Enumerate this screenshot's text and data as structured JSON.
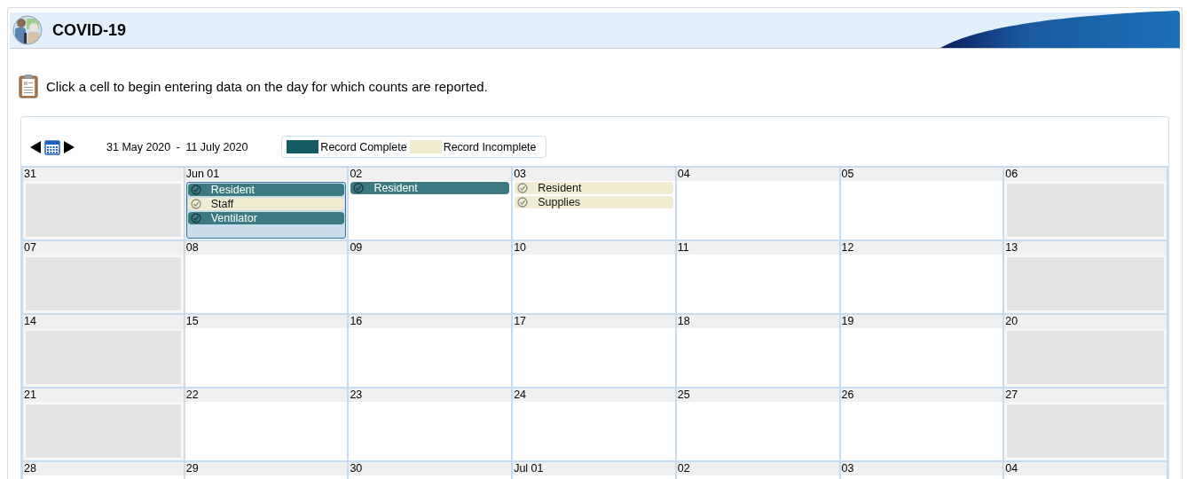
{
  "header": {
    "title": "COVID-19"
  },
  "instruction": "Click a cell to begin entering data on the day for which counts are reported.",
  "toolbar": {
    "range_start": "31 May 2020",
    "range_separator": "-",
    "range_end": "11 July 2020"
  },
  "legend": [
    {
      "label": "Record Complete",
      "complete": true
    },
    {
      "label": "Record Incomplete",
      "complete": false
    }
  ],
  "weeks": [
    {
      "days": [
        {
          "label": "31",
          "weekend": true,
          "selected": false
        },
        {
          "label": "Jun 01",
          "weekend": false,
          "selected": true,
          "records": [
            {
              "name": "Resident",
              "complete": true
            },
            {
              "name": "Staff",
              "complete": false
            },
            {
              "name": "Ventilator",
              "complete": true
            }
          ]
        },
        {
          "label": "02",
          "weekend": false,
          "selected": false,
          "records": [
            {
              "name": "Resident",
              "complete": true
            }
          ]
        },
        {
          "label": "03",
          "weekend": false,
          "selected": false,
          "records": [
            {
              "name": "Resident",
              "complete": false
            },
            {
              "name": "Supplies",
              "complete": false
            }
          ]
        },
        {
          "label": "04",
          "weekend": false,
          "selected": false
        },
        {
          "label": "05",
          "weekend": false,
          "selected": false
        },
        {
          "label": "06",
          "weekend": true,
          "selected": false
        }
      ]
    },
    {
      "days": [
        {
          "label": "07",
          "weekend": true,
          "selected": false
        },
        {
          "label": "08",
          "weekend": false,
          "selected": false
        },
        {
          "label": "09",
          "weekend": false,
          "selected": false
        },
        {
          "label": "10",
          "weekend": false,
          "selected": false
        },
        {
          "label": "11",
          "weekend": false,
          "selected": false
        },
        {
          "label": "12",
          "weekend": false,
          "selected": false
        },
        {
          "label": "13",
          "weekend": true,
          "selected": false
        }
      ]
    },
    {
      "days": [
        {
          "label": "14",
          "weekend": true,
          "selected": false
        },
        {
          "label": "15",
          "weekend": false,
          "selected": false
        },
        {
          "label": "16",
          "weekend": false,
          "selected": false
        },
        {
          "label": "17",
          "weekend": false,
          "selected": false
        },
        {
          "label": "18",
          "weekend": false,
          "selected": false
        },
        {
          "label": "19",
          "weekend": false,
          "selected": false
        },
        {
          "label": "20",
          "weekend": true,
          "selected": false
        }
      ]
    },
    {
      "days": [
        {
          "label": "21",
          "weekend": true,
          "selected": false
        },
        {
          "label": "22",
          "weekend": false,
          "selected": false
        },
        {
          "label": "23",
          "weekend": false,
          "selected": false
        },
        {
          "label": "24",
          "weekend": false,
          "selected": false
        },
        {
          "label": "25",
          "weekend": false,
          "selected": false
        },
        {
          "label": "26",
          "weekend": false,
          "selected": false
        },
        {
          "label": "27",
          "weekend": true,
          "selected": false
        }
      ]
    },
    {
      "days": [
        {
          "label": "28"
        },
        {
          "label": "29"
        },
        {
          "label": "30"
        },
        {
          "label": "Jul 01"
        },
        {
          "label": "02"
        },
        {
          "label": "03"
        },
        {
          "label": "04"
        }
      ]
    }
  ]
}
